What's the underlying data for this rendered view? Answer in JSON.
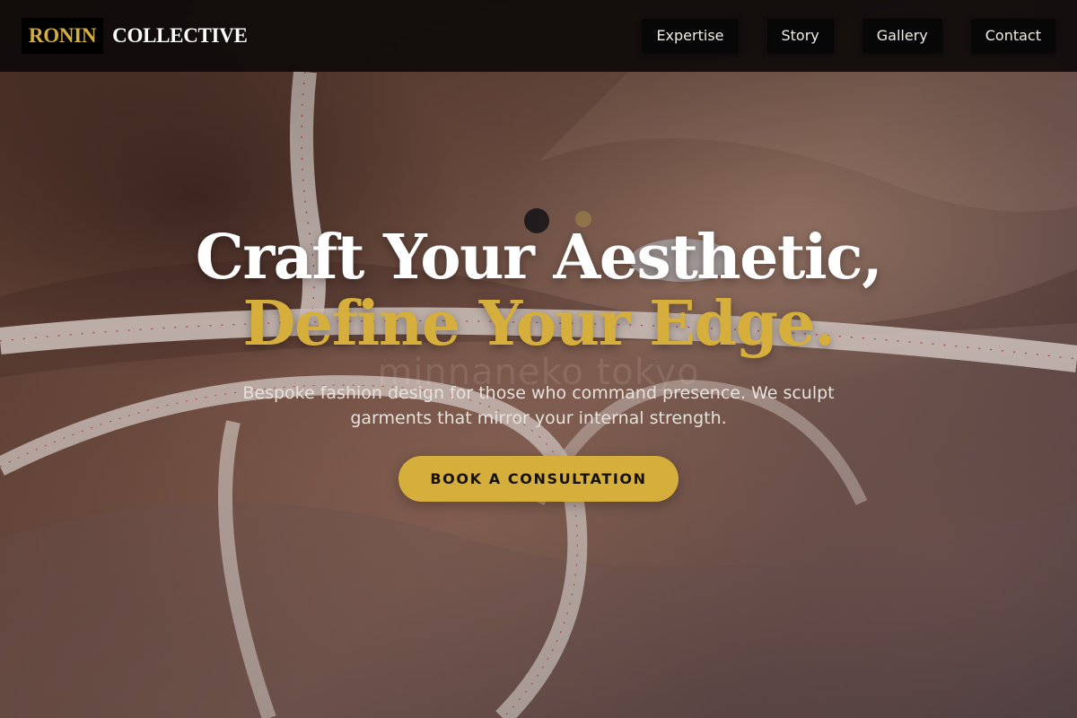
{
  "brand": {
    "name_part1": "RONIN",
    "name_part2": "COLLECTIVE"
  },
  "nav": {
    "items": [
      {
        "label": "Expertise"
      },
      {
        "label": "Story"
      },
      {
        "label": "Gallery"
      },
      {
        "label": "Contact"
      }
    ]
  },
  "hero": {
    "title_line1": "Craft Your Aesthetic,",
    "title_line2": "Define Your Edge.",
    "watermark": "minnaneko tokyo",
    "subtitle": "Bespoke fashion design for those who command presence. We sculpt garments that mirror your internal strength.",
    "cta_label": "BOOK A CONSULTATION",
    "background_image": "fabric-and-tape-measure-photo"
  },
  "colors": {
    "accent_gold": "#d5ae3c",
    "navbar_bg": "#0e0b0a",
    "text_light": "#ffffff"
  }
}
